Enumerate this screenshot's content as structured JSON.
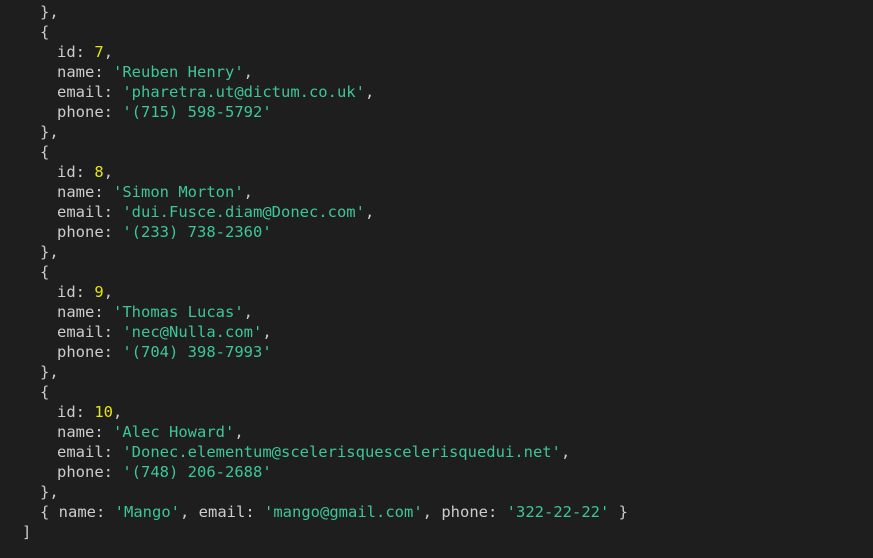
{
  "punctuation": {
    "obj_close": "},",
    "obj_open": "{",
    "array_close": "]",
    "comma": ",",
    "colon": ":",
    "space_brace_close": " }",
    "brace_open_space": "{ "
  },
  "keys": {
    "id": "id",
    "name": "name",
    "email": "email",
    "phone": "phone"
  },
  "records": [
    {
      "id": "7",
      "name": "'Reuben Henry'",
      "email": "'pharetra.ut@dictum.co.uk'",
      "phone": "'(715) 598-5792'"
    },
    {
      "id": "8",
      "name": "'Simon Morton'",
      "email": "'dui.Fusce.diam@Donec.com'",
      "phone": "'(233) 738-2360'"
    },
    {
      "id": "9",
      "name": "'Thomas Lucas'",
      "email": "'nec@Nulla.com'",
      "phone": "'(704) 398-7993'"
    },
    {
      "id": "10",
      "name": "'Alec Howard'",
      "email": "'Donec.elementum@scelerisquescelerisquedui.net'",
      "phone": "'(748) 206-2688'"
    }
  ],
  "inline_record": {
    "name": "'Mango'",
    "email": "'mango@gmail.com'",
    "phone": "'322-22-22'"
  },
  "colors": {
    "background": "#1e1e1e",
    "text": "#cccccc",
    "number": "#e5e510",
    "string": "#3dc69a"
  }
}
